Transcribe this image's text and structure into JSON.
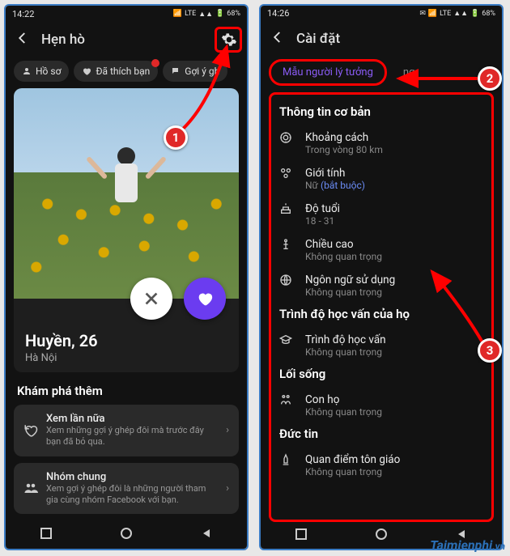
{
  "left": {
    "status": {
      "time": "14:22",
      "battery": "68%",
      "net": "LTE"
    },
    "header": {
      "title": "Hẹn hò"
    },
    "chips": [
      {
        "icon": "profile-icon",
        "label": "Hồ sơ"
      },
      {
        "icon": "heart-icon",
        "label": "Đã thích bạn",
        "dot": true
      },
      {
        "icon": "chat-icon",
        "label": "Gợi ý gh"
      }
    ],
    "profile": {
      "name": "Huyền, 26",
      "location": "Hà Nội"
    },
    "discover_title": "Khám phá thêm",
    "discover": [
      {
        "icon": "rewind-icon",
        "title": "Xem lần nữa",
        "sub": "Xem những gợi ý ghép đôi mà trước đây bạn đã bỏ qua."
      },
      {
        "icon": "group-icon",
        "title": "Nhóm chung",
        "sub": "Xem gợi ý ghép đôi là những người tham gia cùng nhóm Facebook với bạn."
      }
    ]
  },
  "right": {
    "status": {
      "time": "14:26",
      "battery": "68%",
      "net": "LTE"
    },
    "header": {
      "title": "Cài đặt"
    },
    "tabs": {
      "active": "Mẫu người lý tưởng",
      "other": "ng"
    },
    "groups": [
      {
        "title": "Thông tin cơ bản",
        "items": [
          {
            "icon": "target-icon",
            "title": "Khoảng cách",
            "sub": "Trong vòng 80 km"
          },
          {
            "icon": "gender-icon",
            "title": "Giới tính",
            "sub": "Nữ",
            "req": "(bắt buộc)"
          },
          {
            "icon": "cake-icon",
            "title": "Độ tuổi",
            "sub": "18 - 31"
          },
          {
            "icon": "height-icon",
            "title": "Chiều cao",
            "sub": "Không quan trọng"
          },
          {
            "icon": "globe-icon",
            "title": "Ngôn ngữ sử dụng",
            "sub": "Không quan trọng"
          }
        ]
      },
      {
        "title": "Trình độ học vấn của họ",
        "items": [
          {
            "icon": "grad-icon",
            "title": "Trình độ học vấn",
            "sub": "Không quan trọng"
          }
        ]
      },
      {
        "title": "Lối sống",
        "items": [
          {
            "icon": "children-icon",
            "title": "Con họ",
            "sub": "Không quan trọng"
          }
        ]
      },
      {
        "title": "Đức tin",
        "items": [
          {
            "icon": "pray-icon",
            "title": "Quan điểm tôn giáo",
            "sub": "Không quan trọng"
          }
        ]
      }
    ]
  },
  "annotations": {
    "b1": "1",
    "b2": "2",
    "b3": "3"
  },
  "watermark": {
    "a": "Taimienphi",
    "b": ".vn"
  }
}
